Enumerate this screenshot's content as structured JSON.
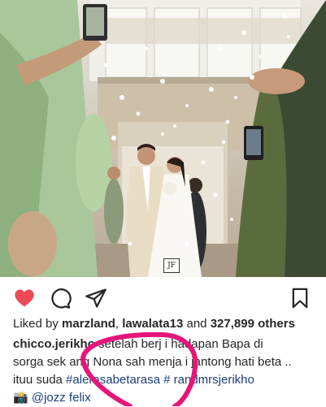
{
  "post": {
    "photo_alt": "Wedding couple walking through confetti",
    "watermark": "JF"
  },
  "actions": {
    "like_icon": "heart-icon",
    "comment_icon": "comment-icon",
    "share_icon": "share-icon",
    "save_icon": "bookmark-icon",
    "like_color": "#ed4956"
  },
  "likes": {
    "prefix": "Liked by ",
    "user1": "marzland",
    "sep": ", ",
    "user2": "lawalata13",
    "and": " and ",
    "count": "327,899 others"
  },
  "caption": {
    "username": "chicco.jerikho",
    "line1_rest": " setelah berj   i hadapan Bapa di",
    "line2": "sorga sek   ang Nona sah menja  i jantong hati beta ..",
    "line3_prefix": "ituu suda   ",
    "hashtag1": "#alerasabetarasa",
    "space": " ",
    "hashtag2": "#   randmrsjerikho",
    "camera_emoji": "📸",
    "mention": "@jozz  felix"
  },
  "annotation_color": "#e6157a"
}
